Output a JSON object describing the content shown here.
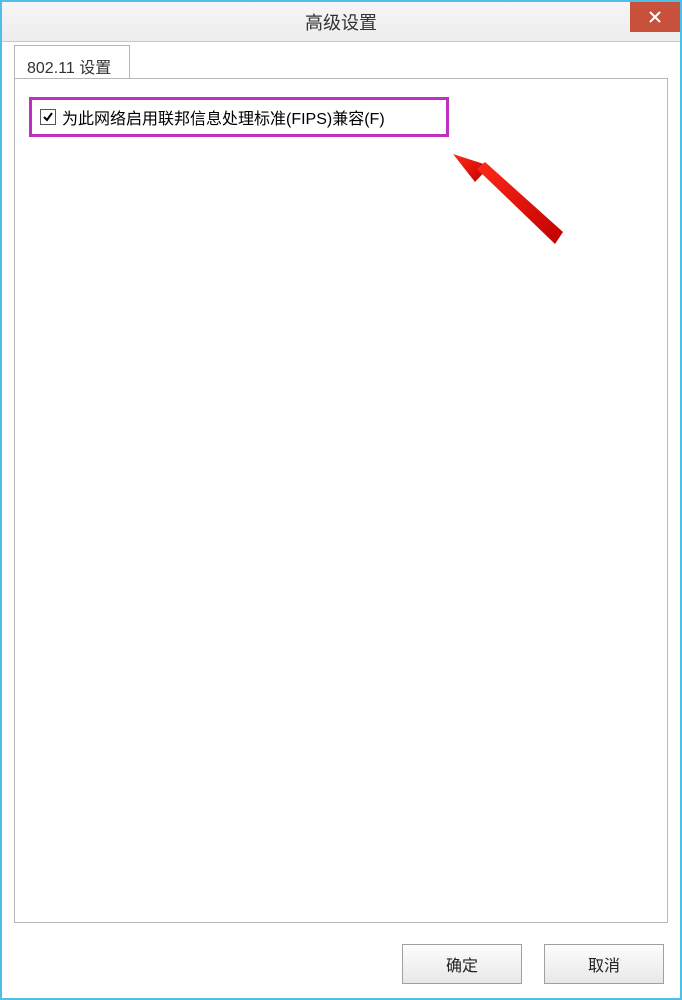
{
  "window": {
    "title": "高级设置"
  },
  "tabs": [
    {
      "label": "802.11 设置"
    }
  ],
  "fips": {
    "checked": true,
    "label": "为此网络启用联邦信息处理标准(FIPS)兼容(F)"
  },
  "buttons": {
    "ok": "确定",
    "cancel": "取消"
  },
  "annotation": {
    "highlight_color": "#c030c0",
    "arrow_color": "#ed1c24"
  }
}
